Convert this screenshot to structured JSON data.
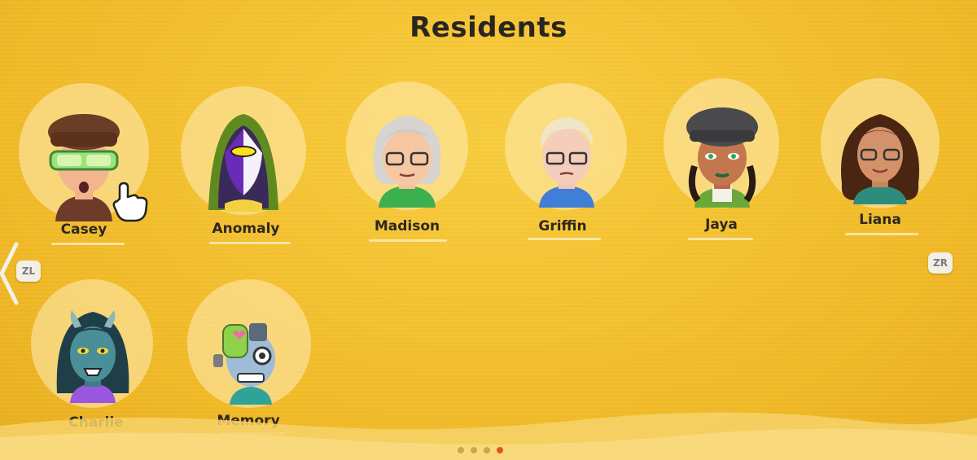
{
  "page": {
    "title": "Residents"
  },
  "residents": [
    {
      "name": "Casey"
    },
    {
      "name": "Anomaly"
    },
    {
      "name": "Madison"
    },
    {
      "name": "Griffin"
    },
    {
      "name": "Jaya"
    },
    {
      "name": "Liana"
    },
    {
      "name": "Charlie"
    },
    {
      "name": "Memory"
    }
  ],
  "controls": {
    "prev_button": "ZL",
    "next_button": "ZR"
  },
  "pagination": {
    "total_pages": 4,
    "current_page": 4
  },
  "colors": {
    "background": "#f1bd2c",
    "active_dot": "#e0542a"
  }
}
